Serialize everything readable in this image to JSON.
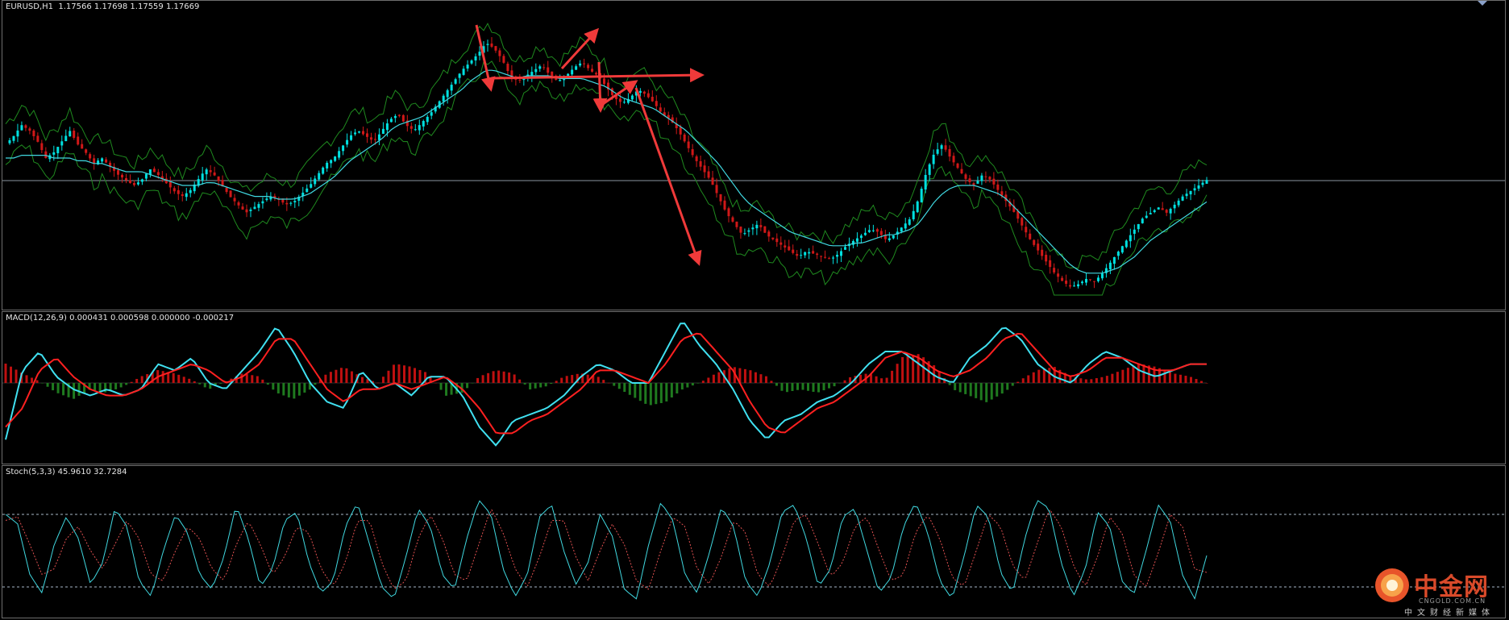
{
  "price_pane": {
    "header": "EURUSD,H1  1.17566 1.17698 1.17559 1.17669"
  },
  "macd_pane": {
    "header": "MACD(12,26,9) 0.000431 0.000598 0.000000 -0.000217"
  },
  "stoch_pane": {
    "header": "Stoch(5,3,3) 45.9610 32.7284"
  },
  "watermark": {
    "title": "中金网",
    "domain": "CNGOLD.COM.CN",
    "subtitle": "中文财经新媒体"
  },
  "colors": {
    "background": "#000000",
    "bull_candle": "#00e0e0",
    "bear_candle": "#d01818",
    "bands": "#1f8a1f",
    "moving_average": "#40d8e0",
    "arrow": "#f03a3a",
    "macd_line": "#40e0f0",
    "signal_line": "#ff2020",
    "hist_positive": "#c01010",
    "hist_negative": "#1f7a1f",
    "stoch_main": "#40d8e0",
    "stoch_signal": "#e05050",
    "level_line": "#a8b8c8"
  },
  "chart_data": [
    {
      "type": "candlestick",
      "symbol": "EURUSD",
      "timeframe": "H1",
      "last_bar": {
        "open": 1.17566,
        "high": 1.17698,
        "low": 1.17559,
        "close": 1.17669
      },
      "series": [
        {
          "values": [
            0.55,
            0.58,
            0.62,
            0.6,
            0.56,
            0.5,
            0.52,
            0.56,
            0.6,
            0.55,
            0.52,
            0.48,
            0.5,
            0.47,
            0.44,
            0.42,
            0.4,
            0.42,
            0.46,
            0.44,
            0.41,
            0.38,
            0.36,
            0.38,
            0.42,
            0.46,
            0.44,
            0.4,
            0.36,
            0.33,
            0.3,
            0.32,
            0.34,
            0.36,
            0.35,
            0.33,
            0.34,
            0.37,
            0.4,
            0.44,
            0.48,
            0.5,
            0.54,
            0.58,
            0.6,
            0.58,
            0.56,
            0.6,
            0.64,
            0.66,
            0.62,
            0.6,
            0.63,
            0.66,
            0.7,
            0.74,
            0.78,
            0.82,
            0.85,
            0.88,
            0.92,
            0.9,
            0.86,
            0.8,
            0.78,
            0.8,
            0.82,
            0.84,
            0.8,
            0.78,
            0.8,
            0.83,
            0.85,
            0.82,
            0.8,
            0.76,
            0.72,
            0.7,
            0.72,
            0.75,
            0.73,
            0.7,
            0.66,
            0.64,
            0.6,
            0.55,
            0.5,
            0.46,
            0.42,
            0.36,
            0.3,
            0.26,
            0.22,
            0.24,
            0.26,
            0.22,
            0.2,
            0.18,
            0.16,
            0.14,
            0.16,
            0.15,
            0.14,
            0.13,
            0.15,
            0.18,
            0.2,
            0.22,
            0.24,
            0.23,
            0.2,
            0.22,
            0.25,
            0.28,
            0.35,
            0.45,
            0.52,
            0.55,
            0.5,
            0.46,
            0.42,
            0.4,
            0.44,
            0.42,
            0.38,
            0.34,
            0.3,
            0.25,
            0.2,
            0.16,
            0.12,
            0.08,
            0.05,
            0.03,
            0.04,
            0.06,
            0.05,
            0.08,
            0.12,
            0.16,
            0.2,
            0.24,
            0.28,
            0.3,
            0.32,
            0.3,
            0.33,
            0.36,
            0.38,
            0.4,
            0.42
          ]
        },
        {
          "values": [
            0.5,
            0.5,
            0.51,
            0.51,
            0.51,
            0.51,
            0.5,
            0.5,
            0.5,
            0.49,
            0.49,
            0.48,
            0.48,
            0.47,
            0.46,
            0.45,
            0.45,
            0.45,
            0.44,
            0.43,
            0.42,
            0.41,
            0.4,
            0.4,
            0.4,
            0.41,
            0.41,
            0.4,
            0.39,
            0.38,
            0.37,
            0.36,
            0.36,
            0.36,
            0.35,
            0.35,
            0.35,
            0.36,
            0.37,
            0.39,
            0.41,
            0.43,
            0.46,
            0.49,
            0.51,
            0.53,
            0.55,
            0.57,
            0.6,
            0.62,
            0.63,
            0.64,
            0.65,
            0.67,
            0.69,
            0.71,
            0.73,
            0.75,
            0.78,
            0.8,
            0.82,
            0.82,
            0.81,
            0.8,
            0.79,
            0.8,
            0.8,
            0.8,
            0.8,
            0.79,
            0.79,
            0.79,
            0.79,
            0.78,
            0.77,
            0.76,
            0.74,
            0.72,
            0.71,
            0.7,
            0.69,
            0.68,
            0.66,
            0.64,
            0.62,
            0.6,
            0.57,
            0.54,
            0.51,
            0.48,
            0.44,
            0.4,
            0.36,
            0.33,
            0.31,
            0.29,
            0.27,
            0.25,
            0.23,
            0.22,
            0.21,
            0.2,
            0.19,
            0.18,
            0.18,
            0.18,
            0.19,
            0.19,
            0.2,
            0.21,
            0.22,
            0.22,
            0.23,
            0.24,
            0.26,
            0.3,
            0.34,
            0.37,
            0.39,
            0.4,
            0.4,
            0.4,
            0.39,
            0.38,
            0.37,
            0.35,
            0.32,
            0.29,
            0.26,
            0.23,
            0.2,
            0.17,
            0.14,
            0.11,
            0.09,
            0.08,
            0.08,
            0.08,
            0.09,
            0.1,
            0.12,
            0.14,
            0.17,
            0.2,
            0.22,
            0.24,
            0.26,
            0.28,
            0.3,
            0.32,
            0.34
          ]
        }
      ]
    },
    {
      "type": "bar",
      "series": [
        {
          "values": [
            0.6,
            0.3,
            0.05,
            -0.3,
            -0.5,
            -0.2,
            -0.3,
            -0.1,
            0.2,
            0.4,
            0.3,
            0.1,
            -0.2,
            0.05,
            0.3,
            0.2,
            -0.3,
            -0.5,
            -0.2,
            0.3,
            0.5,
            0.2,
            0.0,
            0.6,
            0.5,
            0.3,
            -0.4,
            -0.3,
            0.2,
            0.4,
            0.3,
            -0.2,
            -0.1,
            0.2,
            0.3,
            0.2,
            -0.1,
            -0.4,
            -0.7,
            -0.6,
            -0.2,
            0.0,
            0.3,
            0.5,
            0.4,
            0.2,
            -0.3,
            -0.2,
            -0.3,
            -0.1,
            0.2,
            0.3,
            0.1,
            0.8,
            0.9,
            0.5,
            -0.2,
            -0.4,
            -0.6,
            -0.3,
            0.1,
            0.4,
            0.5,
            0.2,
            0.1,
            0.2,
            0.4,
            0.6,
            0.5,
            0.3,
            0.2,
            0.0
          ]
        },
        {
          "values": [
            -0.9,
            0.2,
            0.5,
            0.1,
            -0.1,
            -0.2,
            -0.1,
            -0.2,
            -0.1,
            0.3,
            0.2,
            0.4,
            0.0,
            -0.1,
            0.2,
            0.5,
            0.9,
            0.5,
            0.0,
            -0.3,
            -0.4,
            0.2,
            -0.1,
            0.0,
            -0.2,
            0.1,
            0.1,
            -0.2,
            -0.7,
            -1.0,
            -0.6,
            -0.5,
            -0.4,
            -0.2,
            0.1,
            0.3,
            0.2,
            0.0,
            0.0,
            0.5,
            1.0,
            0.6,
            0.3,
            -0.1,
            -0.6,
            -0.9,
            -0.6,
            -0.5,
            -0.3,
            -0.2,
            0.0,
            0.3,
            0.5,
            0.5,
            0.3,
            0.1,
            0.0,
            0.4,
            0.6,
            0.9,
            0.7,
            0.3,
            0.1,
            0.0,
            0.3,
            0.5,
            0.4,
            0.2,
            0.1,
            0.2,
            0.3,
            0.3
          ]
        },
        {
          "values": [
            -0.7,
            -0.4,
            0.2,
            0.4,
            0.1,
            -0.1,
            -0.2,
            -0.2,
            -0.1,
            0.1,
            0.2,
            0.3,
            0.2,
            0.0,
            0.1,
            0.3,
            0.7,
            0.7,
            0.3,
            -0.1,
            -0.3,
            -0.1,
            -0.1,
            0.0,
            -0.1,
            0.0,
            0.1,
            -0.1,
            -0.4,
            -0.8,
            -0.8,
            -0.6,
            -0.5,
            -0.3,
            -0.1,
            0.2,
            0.2,
            0.1,
            0.0,
            0.3,
            0.7,
            0.8,
            0.5,
            0.2,
            -0.3,
            -0.7,
            -0.8,
            -0.6,
            -0.4,
            -0.3,
            -0.1,
            0.1,
            0.4,
            0.5,
            0.4,
            0.2,
            0.1,
            0.2,
            0.4,
            0.7,
            0.8,
            0.5,
            0.2,
            0.1,
            0.2,
            0.4,
            0.4,
            0.3,
            0.2,
            0.2,
            0.3,
            0.3
          ]
        }
      ]
    },
    {
      "type": "line",
      "ylim": [
        0,
        100
      ],
      "levels": [
        80,
        20
      ],
      "series": [
        {
          "values": [
            80,
            72,
            30,
            15,
            55,
            78,
            60,
            22,
            40,
            85,
            70,
            25,
            12,
            50,
            80,
            65,
            30,
            18,
            45,
            88,
            60,
            20,
            35,
            75,
            82,
            40,
            15,
            25,
            70,
            90,
            55,
            20,
            10,
            45,
            85,
            70,
            30,
            18,
            60,
            92,
            80,
            35,
            12,
            30,
            78,
            88,
            50,
            22,
            40,
            80,
            62,
            18,
            10,
            55,
            90,
            75,
            30,
            15,
            48,
            86,
            70,
            25,
            12,
            40,
            82,
            88,
            60,
            20,
            35,
            78,
            85,
            50,
            15,
            28,
            70,
            90,
            65,
            25,
            10,
            45,
            88,
            78,
            32,
            15,
            60,
            92,
            85,
            40,
            12,
            35,
            82,
            70,
            25,
            14,
            50,
            88,
            74,
            30,
            10,
            46
          ]
        },
        {
          "values": [
            75,
            78,
            55,
            30,
            35,
            60,
            70,
            50,
            35,
            55,
            75,
            60,
            30,
            25,
            50,
            70,
            60,
            35,
            25,
            55,
            75,
            55,
            30,
            45,
            70,
            65,
            35,
            20,
            40,
            75,
            75,
            40,
            18,
            25,
            60,
            80,
            60,
            30,
            25,
            55,
            85,
            65,
            35,
            20,
            45,
            75,
            75,
            45,
            25,
            50,
            72,
            55,
            25,
            18,
            50,
            78,
            70,
            35,
            22,
            45,
            75,
            65,
            30,
            20,
            45,
            75,
            80,
            55,
            28,
            40,
            70,
            78,
            50,
            25,
            30,
            65,
            80,
            60,
            28,
            20,
            50,
            80,
            70,
            38,
            25,
            55,
            85,
            70,
            38,
            20,
            45,
            78,
            65,
            30,
            20,
            48,
            80,
            70,
            35,
            32
          ]
        }
      ]
    }
  ]
}
